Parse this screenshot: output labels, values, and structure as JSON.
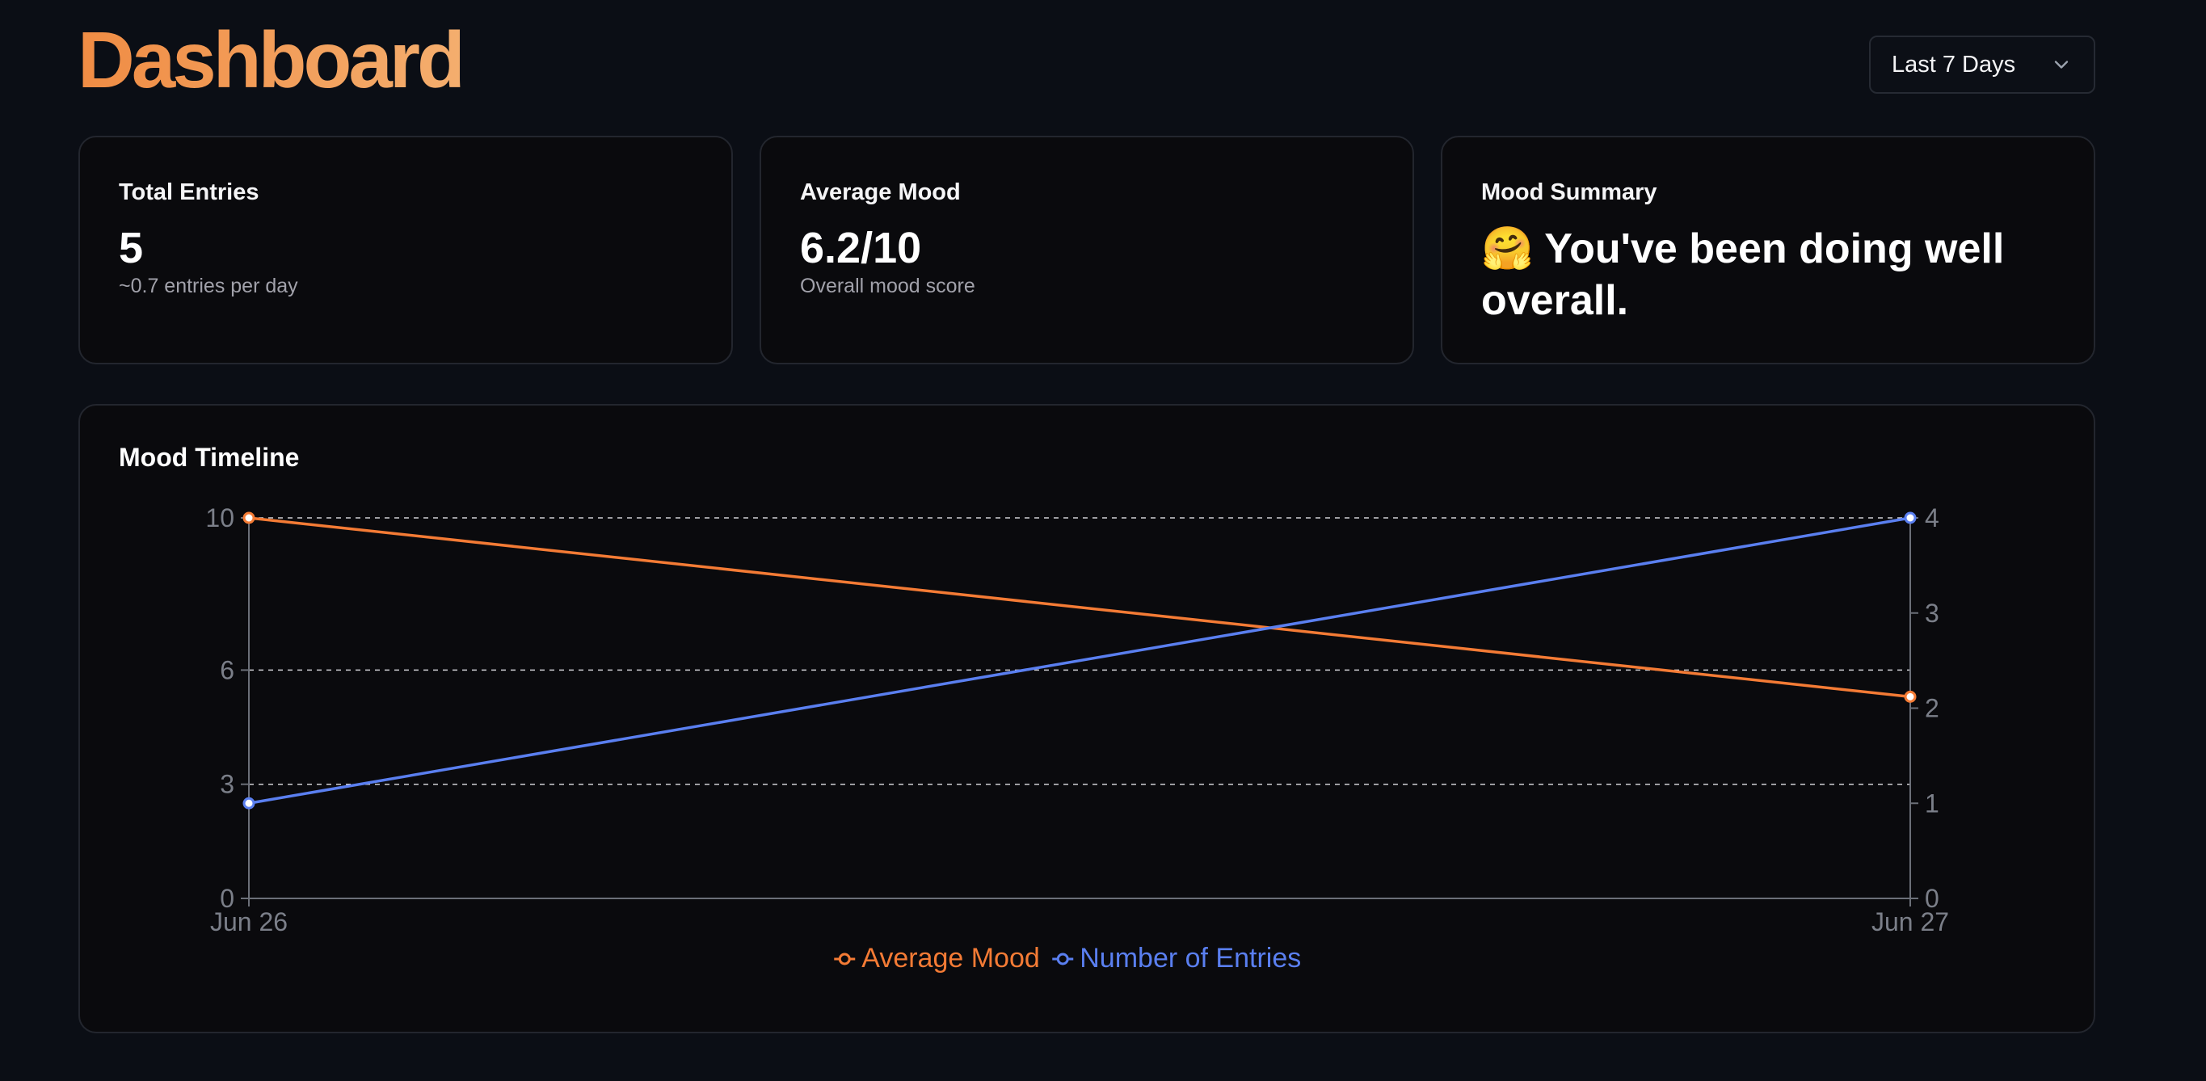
{
  "header": {
    "title": "Dashboard",
    "range_select": {
      "value": "Last 7 Days"
    }
  },
  "stats": {
    "total_entries": {
      "label": "Total Entries",
      "value": "5",
      "sub": "~0.7 entries per day"
    },
    "average_mood": {
      "label": "Average Mood",
      "value": "6.2/10",
      "sub": "Overall mood score"
    },
    "mood_summary": {
      "label": "Mood Summary",
      "emoji": "🤗",
      "text": "You've been doing well overall."
    }
  },
  "chart_card": {
    "title": "Mood Timeline"
  },
  "colors": {
    "accent": "#f08c44",
    "mood_line": "#f47b35",
    "entries_line": "#5a7ff0",
    "background": "#0b0e15",
    "card": "#0a0a0d"
  },
  "chart_data": {
    "type": "line",
    "x": [
      "Jun 26",
      "Jun 27"
    ],
    "series": [
      {
        "name": "Average Mood",
        "axis": "left",
        "color": "#f47b35",
        "values": [
          10,
          5.3
        ]
      },
      {
        "name": "Number of Entries",
        "axis": "right",
        "color": "#5a7ff0",
        "values": [
          1,
          4
        ]
      }
    ],
    "y_left": {
      "ticks": [
        0,
        3,
        6,
        10
      ],
      "ylim": [
        0,
        10
      ]
    },
    "y_right": {
      "ticks": [
        0,
        1,
        2,
        3,
        4
      ],
      "ylim": [
        0,
        4
      ]
    },
    "grid": "horizontal dashed",
    "legend": "bottom-center"
  }
}
